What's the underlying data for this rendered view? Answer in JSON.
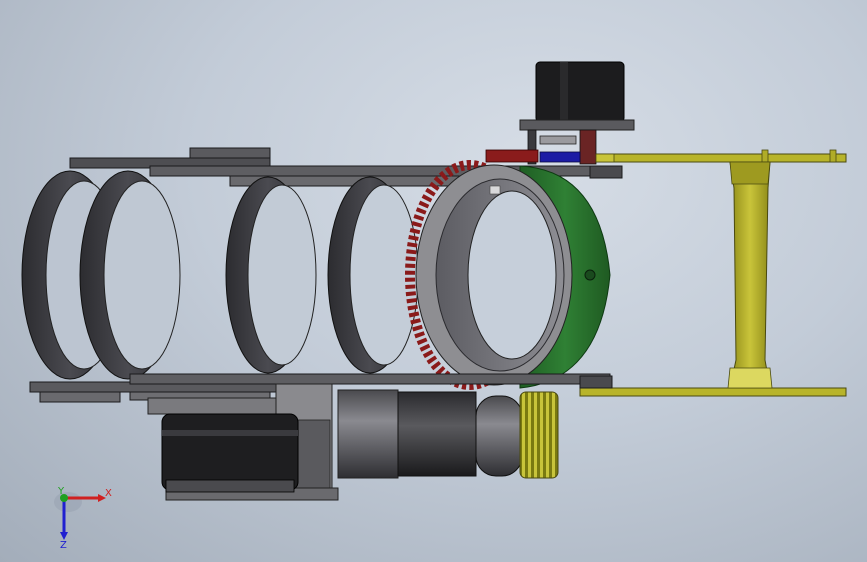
{
  "viewport": {
    "background": "#c6cfda"
  },
  "model": {
    "colors": {
      "ring_dark": "#3a3a3e",
      "ring_grey": "#8c8c90",
      "plate_grey": "#6e6e72",
      "green_band": "#2e7a32",
      "gear_red": "#a02020",
      "yellow_frame": "#c6c22e",
      "motor_black": "#1e1e20",
      "blue_part": "#1a1aa0"
    },
    "parts": [
      "ring",
      "ring",
      "ring",
      "ring",
      "bearing-ring",
      "ring-gear",
      "green-band",
      "motor",
      "motor-housing",
      "pinion-gear",
      "yellow-frame",
      "top-motor",
      "base-plate",
      "roller"
    ]
  },
  "triad": {
    "x_label": "X",
    "y_label": "Y",
    "z_label": "Z",
    "x_color": "#d02020",
    "y_color": "#20a020",
    "z_color": "#2020d0"
  }
}
